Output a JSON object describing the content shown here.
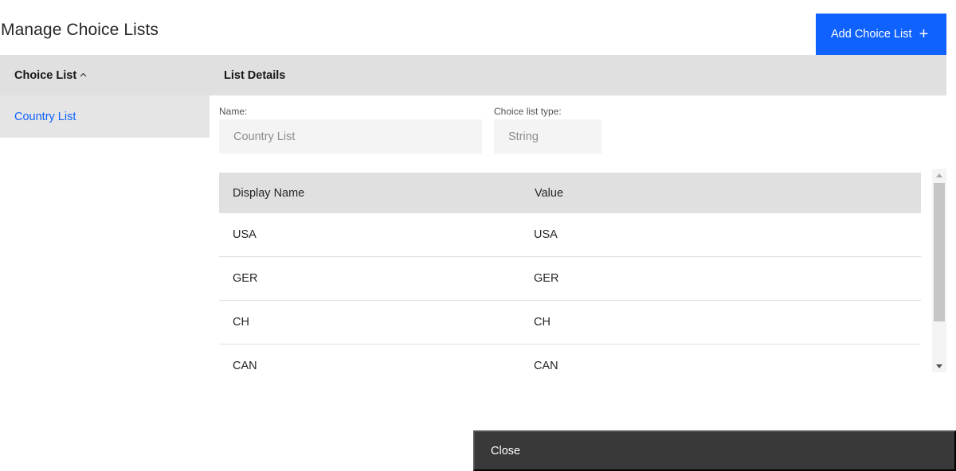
{
  "page": {
    "title": "Manage Choice Lists",
    "add_button_label": "Add Choice List",
    "add_button_icon": "+"
  },
  "sidebar": {
    "header": "Choice List",
    "sort_icon": "^",
    "items": [
      {
        "label": "Country List",
        "selected": true
      }
    ]
  },
  "details": {
    "header": "List Details",
    "name_label": "Name:",
    "name_value": "Country List",
    "type_label": "Choice list type:",
    "type_value": "String"
  },
  "table": {
    "columns": [
      "Display Name",
      "Value"
    ],
    "rows": [
      {
        "display": "USA",
        "value": "USA"
      },
      {
        "display": "GER",
        "value": "GER"
      },
      {
        "display": "CH",
        "value": "CH"
      },
      {
        "display": "CAN",
        "value": "CAN"
      }
    ]
  },
  "footer": {
    "close_label": "Close"
  },
  "colors": {
    "accent": "#0f62fe",
    "header_bg": "#e0e0e0",
    "footer_bg": "#393939"
  }
}
